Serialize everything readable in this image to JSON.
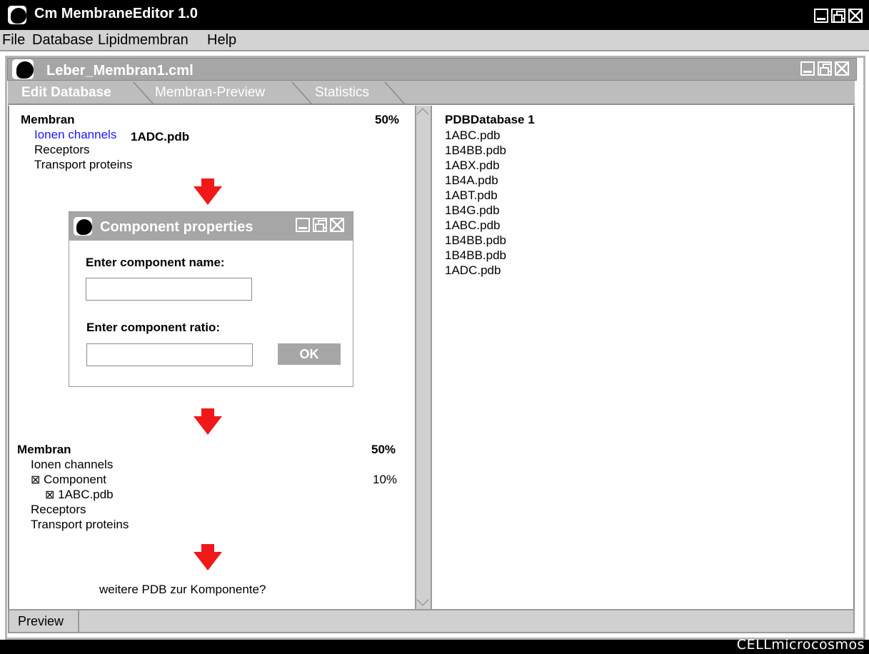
{
  "app": {
    "title": "Cm MembraneEditor 1.0"
  },
  "menu": [
    "File",
    "Database",
    "Lipidmembran",
    "Help"
  ],
  "document": {
    "title": "Leber_Membran1.cml",
    "tabs": [
      "Edit Database",
      "Membran-Preview",
      "Statistics"
    ],
    "active_tab": "Edit Database"
  },
  "tree_top": {
    "root": "Membran",
    "percent": "50%",
    "items": [
      "Ionen channels",
      "Receptors",
      "Transport proteins"
    ],
    "dragged_item": "1ADC.pdb"
  },
  "dialog": {
    "title": "Component properties",
    "name_label": "Enter component name:",
    "name_value": "",
    "ratio_label": "Enter component ratio:",
    "ratio_value": "",
    "ok_label": "OK"
  },
  "tree_bottom": {
    "root": "Membran",
    "percent": "50%",
    "item_1": "Ionen channels",
    "component": "Component",
    "component_percent": "10%",
    "component_child": "1ABC.pdb",
    "item_2": "Receptors",
    "item_3": "Transport proteins",
    "check_glyph": "⊠"
  },
  "question": "weitere PDB zur Komponente?",
  "pdb_database": {
    "title": "PDBDatabase 1",
    "entries": [
      "1ABC.pdb",
      "1B4BB.pdb",
      "1ABX.pdb",
      "1B4A.pdb",
      "1ABT.pdb",
      "1B4G.pdb",
      "1ABC.pdb",
      "1B4BB.pdb",
      "1B4BB.pdb",
      "1ADC.pdb"
    ]
  },
  "statusbar": {
    "preview_label": "Preview"
  },
  "brand": "CELLmicrocosmos",
  "colors": {
    "titlebar": "#000000",
    "inactive_title": "#a6a6a6",
    "arrow": "#f01818",
    "link_blue": "#1a1aff"
  }
}
